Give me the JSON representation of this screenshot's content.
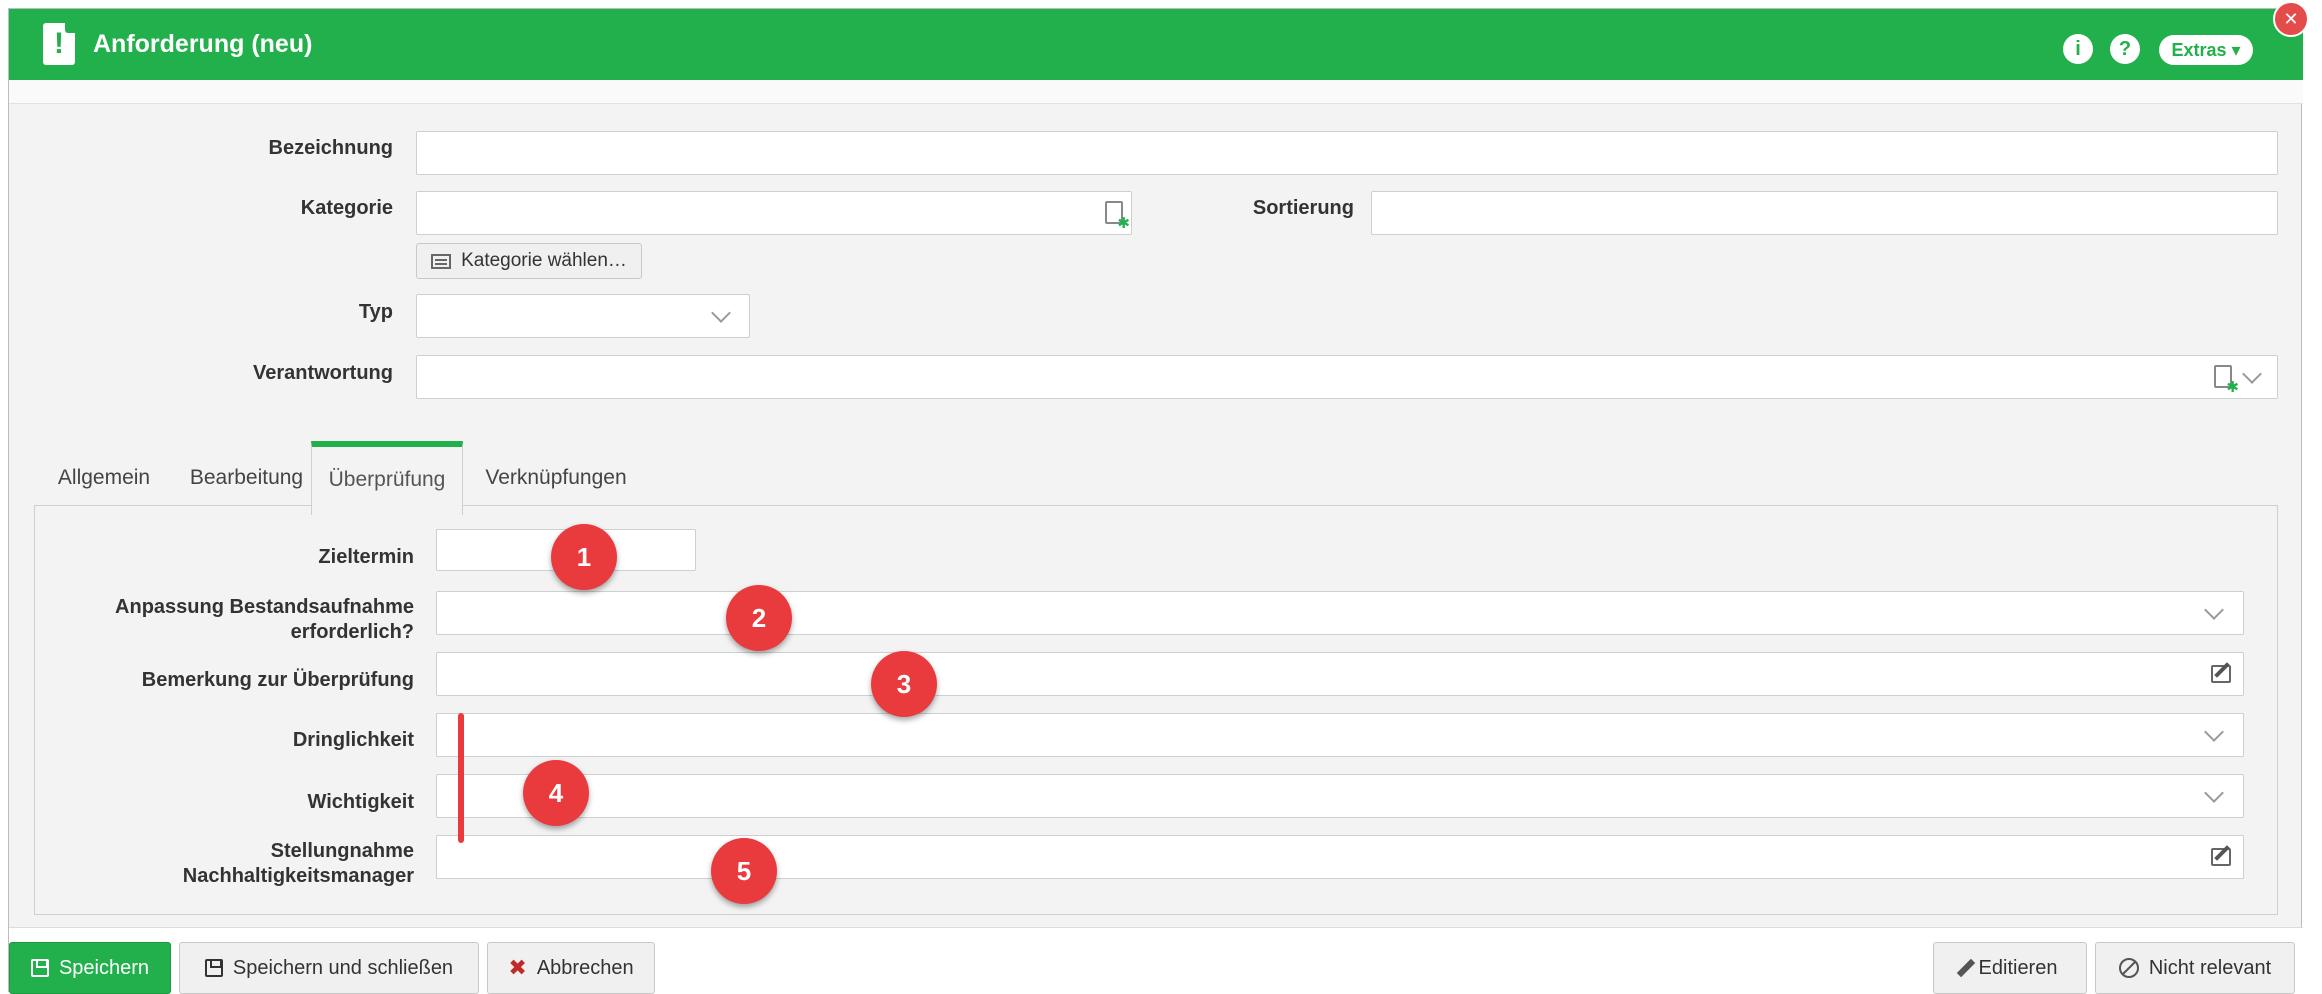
{
  "window": {
    "title": "Anforderung (neu)",
    "info_icon": "i",
    "help_icon": "?",
    "extras_label": "Extras ▾",
    "close_label": "✕"
  },
  "form": {
    "bezeichnung": {
      "label": "Bezeichnung",
      "value": ""
    },
    "kategorie": {
      "label": "Kategorie",
      "value": "",
      "choose_button": "Kategorie wählen…"
    },
    "sortierung": {
      "label": "Sortierung",
      "value": ""
    },
    "typ": {
      "label": "Typ",
      "value": ""
    },
    "verantwortung": {
      "label": "Verantwortung",
      "value": ""
    }
  },
  "tabs": [
    {
      "label": "Allgemein",
      "active": false
    },
    {
      "label": "Bearbeitung",
      "active": false
    },
    {
      "label": "Überprüfung",
      "active": true
    },
    {
      "label": "Verknüpfungen",
      "active": false
    }
  ],
  "review": {
    "zieltermin": {
      "label": "Zieltermin",
      "value": ""
    },
    "anpassung": {
      "label_line1": "Anpassung Bestandsaufnahme",
      "label_line2": "erforderlich?",
      "value": ""
    },
    "bemerkung": {
      "label": "Bemerkung zur Überprüfung",
      "value": ""
    },
    "dringlichkeit": {
      "label": "Dringlichkeit",
      "value": ""
    },
    "wichtigkeit": {
      "label": "Wichtigkeit",
      "value": ""
    },
    "stellungnahme": {
      "label_line1": "Stellungnahme",
      "label_line2": "Nachhaltigkeitsmanager",
      "value": ""
    }
  },
  "markers": [
    "1",
    "2",
    "3",
    "4",
    "5"
  ],
  "footer": {
    "save": "Speichern",
    "save_close": "Speichern und schließen",
    "cancel": "Abbrechen",
    "edit": "Editieren",
    "not_relevant": "Nicht relevant"
  },
  "colors": {
    "accent": "#21b04b",
    "marker": "#e93b3d"
  },
  "icons": {
    "app": "requirement-icon",
    "kategorie": "new-document-icon",
    "verantwortung": "new-document-icon",
    "edit": "edit-icon",
    "select": "chevron-down-icon"
  }
}
